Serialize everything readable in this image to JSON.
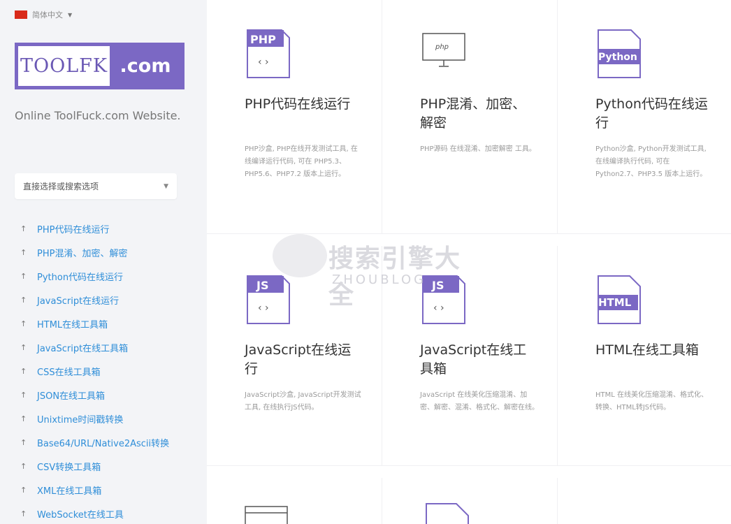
{
  "sidebar": {
    "language": "简体中文",
    "logo": {
      "left": "TOOLFK",
      "right": ".com"
    },
    "tagline": "Online ToolFuck.com Website.",
    "select_placeholder": "直接选择或搜索选项",
    "nav_items": [
      "PHP代码在线运行",
      "PHP混淆、加密、解密",
      "Python代码在线运行",
      "JavaScript在线运行",
      "HTML在线工具箱",
      "JavaScript在线工具箱",
      "CSS在线工具箱",
      "JSON在线工具箱",
      "Unixtime时间戳转换",
      "Base64/URL/Native2Ascii转换",
      "CSV转换工具箱",
      "XML在线工具箱",
      "WebSocket在线工具"
    ]
  },
  "tools": [
    {
      "icon": "php-file-icon",
      "badge": "PHP",
      "title": "PHP代码在线运行",
      "desc": "PHP沙盒, PHP在线开发测试工具, 在线编译运行代码, 可在 PHP5.3、PHP5.6、PHP7.2 版本上运行。"
    },
    {
      "icon": "php-monitor-icon",
      "badge": "php",
      "title": "PHP混淆、加密、解密",
      "desc": "PHP源码 在线混淆、加密解密 工具。"
    },
    {
      "icon": "python-file-icon",
      "badge": "Python",
      "title": "Python代码在线运行",
      "desc": "Python沙盒, Python开发测试工具, 在线编译执行代码, 可在 Python2.7、PHP3.5 版本上运行。"
    },
    {
      "icon": "js-file-icon",
      "badge": "JS",
      "title": "JavaScript在线运行",
      "desc": "JavaScript沙盒, JavaScript开发测试工具, 在线执行JS代码。"
    },
    {
      "icon": "js-file-icon",
      "badge": "JS",
      "title": "JavaScript在线工具箱",
      "desc": "JavaScript 在线美化压缩混淆、加密、解密、混淆、格式化、解密在线。"
    },
    {
      "icon": "html-file-icon",
      "badge": "HTML",
      "title": "HTML在线工具箱",
      "desc": "HTML 在线美化压缩混淆、格式化、转换、HTML转JS代码。"
    }
  ],
  "watermark": {
    "cn": "搜索引擎大全",
    "en": "ZHOUBLOG"
  },
  "colors": {
    "accent": "#7b68c4",
    "link": "#2f8ed8",
    "sidebar_bg": "#f3f4f7"
  }
}
